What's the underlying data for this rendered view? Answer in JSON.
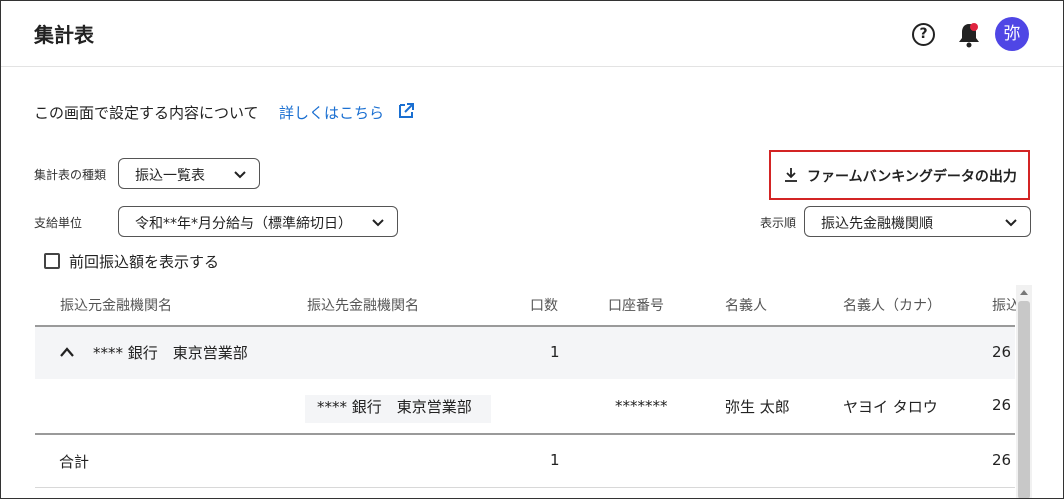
{
  "header": {
    "title": "集計表",
    "help_glyph": "?",
    "avatar_initial": "弥",
    "notification_dot_color": "#e0243f",
    "avatar_color": "#4f46e5"
  },
  "intro": {
    "text": "この画面で設定する内容について",
    "link_text": "詳しくはこちら"
  },
  "form": {
    "report_type_label": "集計表の種類",
    "report_type_value": "振込一覧表",
    "payment_unit_label": "支給単位",
    "payment_unit_value": "令和**年*月分給与（標準締切日）",
    "sort_label": "表示順",
    "sort_value": "振込先金融機関順",
    "export_button": "ファームバンキングデータの出力",
    "show_previous_label": "前回振込額を表示する"
  },
  "table": {
    "headers": [
      "振込元金融機関名",
      "振込先金融機関名",
      "口数",
      "口座番号",
      "名義人",
      "名義人（カナ）",
      "振込"
    ],
    "group_row": {
      "source_bank": "****  銀行　東京営業部",
      "count": "1",
      "amount_partial": "26"
    },
    "detail_row": {
      "dest_bank": "****  銀行　東京営業部",
      "account_number": "*******",
      "holder": "弥生 太郎",
      "holder_kana": "ヤヨイ タロウ",
      "amount_partial": "26"
    },
    "total_row": {
      "label": "合計",
      "count": "1",
      "amount_partial": "26"
    }
  },
  "colors": {
    "link": "#1a6fd1",
    "export_border": "#d32424"
  }
}
